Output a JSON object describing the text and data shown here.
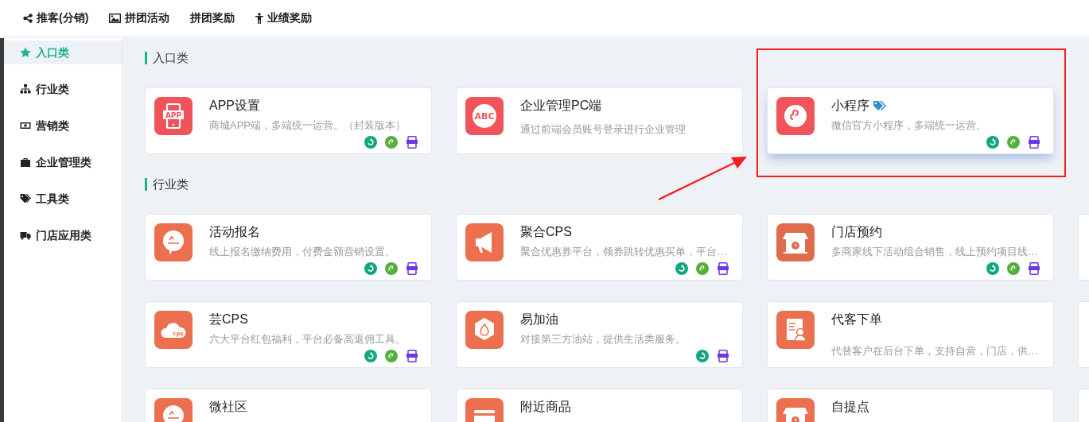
{
  "top_nav": [
    {
      "label": "推客(分销)",
      "kind": "share"
    },
    {
      "label": "拼团活动",
      "kind": "image"
    },
    {
      "label": "拼团奖励",
      "kind": "plain"
    },
    {
      "label": "业绩奖励",
      "kind": "person"
    }
  ],
  "sidebar": {
    "items": [
      {
        "label": "入口类",
        "kind": "star",
        "selected": true
      },
      {
        "label": "行业类",
        "kind": "sitemap",
        "selected": false
      },
      {
        "label": "营销类",
        "kind": "money",
        "selected": false
      },
      {
        "label": "企业管理类",
        "kind": "briefcase",
        "selected": false
      },
      {
        "label": "工具类",
        "kind": "tags",
        "selected": false
      },
      {
        "label": "门店应用类",
        "kind": "truck",
        "selected": false
      }
    ]
  },
  "sections": [
    {
      "title": "入口类",
      "cards": [
        {
          "title": "APP设置",
          "desc": "商城APP端，多端统一运营。（封装版本）",
          "kind": "app",
          "icon_text": "APP",
          "color": "#f0545a",
          "highlighted": false,
          "platforms": [
            {
              "kind": "wechat"
            },
            {
              "kind": "mini"
            },
            {
              "kind": "wap"
            }
          ]
        },
        {
          "title": "企业管理PC端",
          "desc": "通过前端会员账号登录进行企业管理",
          "kind": "abc",
          "icon_text": "ABC",
          "color": "#f0545a",
          "highlighted": false
        },
        {
          "title": "小程序",
          "desc": "微信官方小程序，多端统一运营。",
          "kind": "mini",
          "color": "#f0545a",
          "tag": true,
          "highlighted": true,
          "platforms": [
            {
              "kind": "wechat"
            },
            {
              "kind": "mini"
            },
            {
              "kind": "wap"
            }
          ]
        }
      ]
    },
    {
      "title": "行业类",
      "cards": [
        {
          "title": "活动报名",
          "desc": "线上报名缴纳费用，付费金额营销设置。",
          "kind": "bubble",
          "color": "#ec6f4f",
          "highlighted": false,
          "platforms": [
            {
              "kind": "wechat"
            },
            {
              "kind": "mini"
            },
            {
              "kind": "wap"
            }
          ]
        },
        {
          "title": "聚合CPS",
          "desc": "聚合优惠券平台，领券跳转优惠买单，平台…",
          "kind": "megaphone",
          "color": "#ec6f4f",
          "highlighted": false,
          "platforms": [
            {
              "kind": "wechat"
            },
            {
              "kind": "mini"
            },
            {
              "kind": "wap"
            }
          ]
        },
        {
          "title": "门店预约",
          "desc": "多商家线下活动组合销售，线上预约项目线…",
          "kind": "store",
          "color": "#e06c50",
          "highlighted": false,
          "platforms": [
            {
              "kind": "wechat"
            },
            {
              "kind": "mini"
            },
            {
              "kind": "wap"
            }
          ]
        },
        {
          "title": "芸CPS",
          "desc": "六大平台红包福利，平台必备高返佣工具。",
          "kind": "cloud",
          "icon_text": "cps",
          "color": "#ec6f4f",
          "highlighted": false,
          "platforms": [
            {
              "kind": "wechat"
            },
            {
              "kind": "mini"
            },
            {
              "kind": "wap"
            }
          ]
        },
        {
          "title": "易加油",
          "desc": "对接第三方油站，提供生活类服务。",
          "kind": "drop",
          "color": "#ec6f4f",
          "highlighted": false,
          "platforms": [
            {
              "kind": "wechat"
            },
            {
              "kind": "wap"
            }
          ]
        },
        {
          "title": "代客下单",
          "desc": "代替客户在后台下单，支持自营，门店，供…",
          "kind": "form",
          "color": "#ec6f4f",
          "highlighted": false
        },
        {
          "title": "微社区",
          "kind": "bubble",
          "color": "#ec6f4f",
          "highlighted": false
        },
        {
          "title": "附近商品",
          "kind": "card",
          "color": "#ec6f4f",
          "highlighted": false
        },
        {
          "title": "自提点",
          "kind": "store",
          "color": "#ec6f4f",
          "highlighted": false
        }
      ]
    }
  ]
}
